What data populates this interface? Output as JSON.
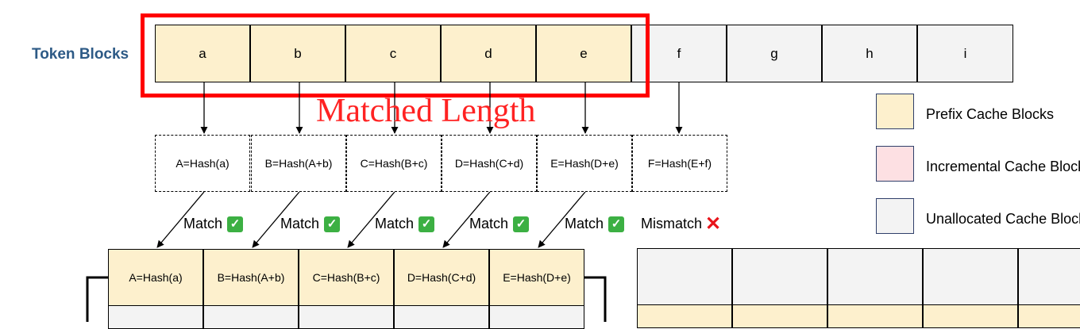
{
  "title": "Token Blocks",
  "tokens": [
    "a",
    "b",
    "c",
    "d",
    "e",
    "f",
    "g",
    "h",
    "i"
  ],
  "matched_label": "Matched Length",
  "hashes": [
    "A=Hash(a)",
    "B=Hash(A+b)",
    "C=Hash(B+c)",
    "D=Hash(C+d)",
    "E=Hash(D+e)",
    "F=Hash(E+f)"
  ],
  "statuses": [
    "Match",
    "Match",
    "Match",
    "Match",
    "Match",
    "Mismatch"
  ],
  "status_icons": [
    "check-icon",
    "check-icon",
    "check-icon",
    "check-icon",
    "check-icon",
    "cross-icon"
  ],
  "cache_row": [
    "A=Hash(a)",
    "B=Hash(A+b)",
    "C=Hash(B+c)",
    "D=Hash(C+d)",
    "E=Hash(D+e)"
  ],
  "legend": [
    {
      "label": "Prefix Cache Blocks",
      "color": "#fdf0cd"
    },
    {
      "label": "Incremental Cache Blocks",
      "color": "#fde0e3"
    },
    {
      "label": "Unallocated Cache Blocks",
      "color": "#f3f3f3"
    }
  ],
  "colors": {
    "prefix": "#fdf0cd",
    "unallocated": "#f3f3f3",
    "highlight": "#ff0000",
    "title": "#2d5a86"
  }
}
